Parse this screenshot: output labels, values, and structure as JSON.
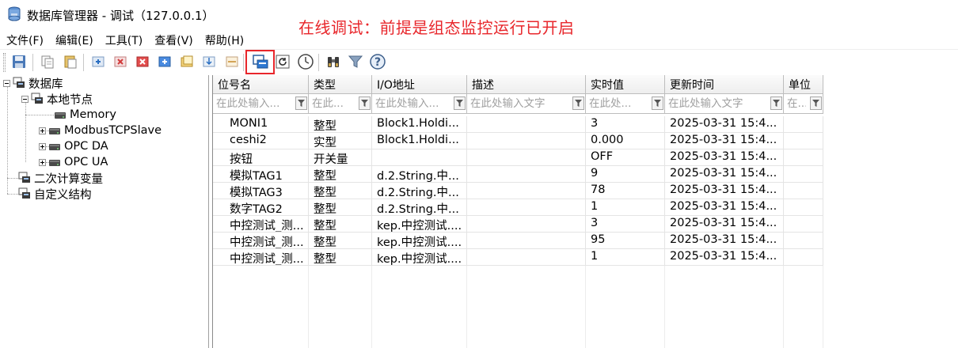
{
  "window": {
    "title": "数据库管理器 - 调试（127.0.0.1）",
    "annotation": "在线调试：前提是组态监控运行已开启"
  },
  "menu": [
    "文件(F)",
    "编辑(E)",
    "工具(T)",
    "查看(V)",
    "帮助(H)"
  ],
  "toolbar": {
    "buttons": [
      "save-icon",
      "copy-icon",
      "paste-icon",
      "add-node-icon",
      "delete-icon",
      "delete-red-icon",
      "add-blue-icon",
      "folder-icon",
      "import-icon",
      "export-icon",
      "online-debug-icon",
      "refresh-icon",
      "history-clock-icon",
      "binoculars-icon",
      "filter-icon",
      "help-icon"
    ],
    "highlighted": "online-debug-icon"
  },
  "tree": {
    "root": "数据库",
    "local_node": "本地节点",
    "children": [
      "Memory",
      "ModbusTCPSlave",
      "OPC DA",
      "OPC UA"
    ],
    "calc_vars": "二次计算变量",
    "custom_struct": "自定义结构"
  },
  "grid": {
    "columns": [
      "位号名",
      "类型",
      "I/O地址",
      "描述",
      "实时值",
      "更新时间",
      "单位"
    ],
    "filters": [
      "在此处输入...",
      "在此...",
      "在此处输入...",
      "在此处输入文字",
      "在此处...",
      "在此处输入文字",
      "在..."
    ],
    "rows": [
      [
        "MONI1",
        "整型",
        "Block1.Holdi...",
        "",
        "3",
        "2025-03-31 15:4...",
        ""
      ],
      [
        "ceshi2",
        "实型",
        "Block1.Holdi...",
        "",
        "0.000",
        "2025-03-31 15:4...",
        ""
      ],
      [
        "按钮",
        "开关量",
        "",
        "",
        "OFF",
        "2025-03-31 15:4...",
        ""
      ],
      [
        "模拟TAG1",
        "整型",
        "d.2.String.中...",
        "",
        "9",
        "2025-03-31 15:4...",
        ""
      ],
      [
        "模拟TAG3",
        "整型",
        "d.2.String.中...",
        "",
        "78",
        "2025-03-31 15:4...",
        ""
      ],
      [
        "数字TAG2",
        "整型",
        "d.2.String.中...",
        "",
        "1",
        "2025-03-31 15:4...",
        ""
      ],
      [
        "中控测试_测...",
        "整型",
        "kep.中控测试....",
        "",
        "3",
        "2025-03-31 15:4...",
        ""
      ],
      [
        "中控测试_测...",
        "整型",
        "kep.中控测试....",
        "",
        "95",
        "2025-03-31 15:4...",
        ""
      ],
      [
        "中控测试_测...",
        "整型",
        "kep.中控测试....",
        "",
        "1",
        "2025-03-31 15:4...",
        ""
      ]
    ]
  },
  "colors": {
    "annotation": "#e8262b",
    "highlight_border": "#e8262b"
  }
}
